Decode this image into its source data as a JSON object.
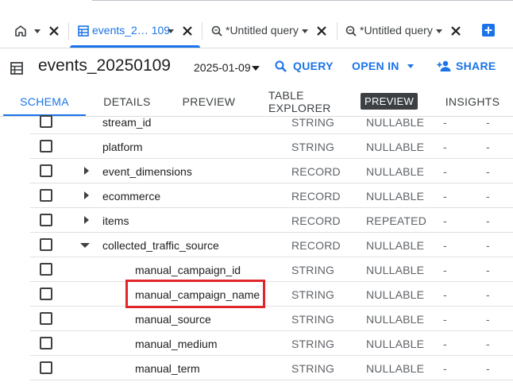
{
  "tabs": [
    {
      "label": "",
      "icon": "home-icon",
      "active": false
    },
    {
      "label": "events_2… 109",
      "icon": "table-icon",
      "active": true
    },
    {
      "label": "*Untitled query",
      "icon": "query-icon",
      "active": false
    },
    {
      "label": "*Untitled query",
      "icon": "query-icon",
      "active": false
    }
  ],
  "header": {
    "title": "events_20250109",
    "date": "2025-01-09",
    "query_label": "QUERY",
    "open_in_label": "OPEN IN",
    "share_label": "SHARE"
  },
  "subtabs": [
    {
      "label": "SCHEMA",
      "active": true
    },
    {
      "label": "DETAILS",
      "active": false
    },
    {
      "label": "PREVIEW",
      "active": false
    },
    {
      "label": "TABLE EXPLORER",
      "active": false
    },
    {
      "label": "INSIGHTS",
      "active": false
    }
  ],
  "preview_badge": "PREVIEW",
  "schema": {
    "rows": [
      {
        "name": "stream_id",
        "type": "STRING",
        "mode": "NULLABLE",
        "col4": "-",
        "col5": "-",
        "expander": "none",
        "level": 0
      },
      {
        "name": "platform",
        "type": "STRING",
        "mode": "NULLABLE",
        "col4": "-",
        "col5": "-",
        "expander": "none",
        "level": 0
      },
      {
        "name": "event_dimensions",
        "type": "RECORD",
        "mode": "NULLABLE",
        "col4": "-",
        "col5": "-",
        "expander": "collapsed",
        "level": 0
      },
      {
        "name": "ecommerce",
        "type": "RECORD",
        "mode": "NULLABLE",
        "col4": "-",
        "col5": "-",
        "expander": "collapsed",
        "level": 0
      },
      {
        "name": "items",
        "type": "RECORD",
        "mode": "REPEATED",
        "col4": "-",
        "col5": "-",
        "expander": "collapsed",
        "level": 0
      },
      {
        "name": "collected_traffic_source",
        "type": "RECORD",
        "mode": "NULLABLE",
        "col4": "-",
        "col5": "-",
        "expander": "expanded",
        "level": 0
      },
      {
        "name": "manual_campaign_id",
        "type": "STRING",
        "mode": "NULLABLE",
        "col4": "-",
        "col5": "-",
        "expander": "none",
        "level": 1
      },
      {
        "name": "manual_campaign_name",
        "type": "STRING",
        "mode": "NULLABLE",
        "col4": "-",
        "col5": "-",
        "expander": "none",
        "level": 1,
        "highlighted": true
      },
      {
        "name": "manual_source",
        "type": "STRING",
        "mode": "NULLABLE",
        "col4": "-",
        "col5": "-",
        "expander": "none",
        "level": 1
      },
      {
        "name": "manual_medium",
        "type": "STRING",
        "mode": "NULLABLE",
        "col4": "-",
        "col5": "-",
        "expander": "none",
        "level": 1
      },
      {
        "name": "manual_term",
        "type": "STRING",
        "mode": "NULLABLE",
        "col4": "-",
        "col5": "-",
        "expander": "none",
        "level": 1
      },
      {
        "name": "",
        "type": "",
        "mode": "",
        "col4": "",
        "col5": "",
        "expander": "none",
        "level": 1
      }
    ]
  },
  "colors": {
    "accent": "#1a73e8",
    "highlight": "#e0262b",
    "text": "#202124",
    "muted": "#5f6368"
  }
}
